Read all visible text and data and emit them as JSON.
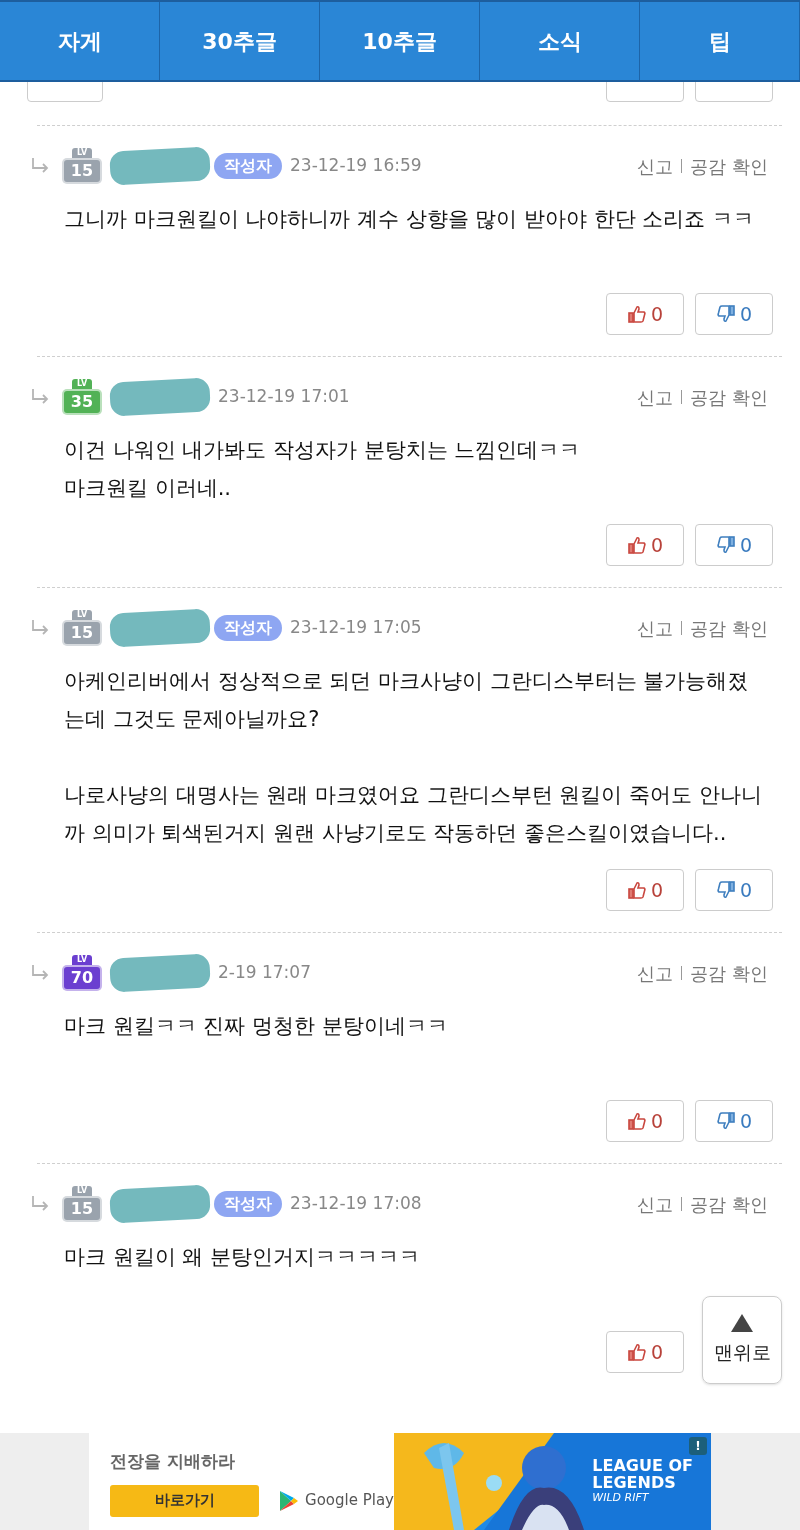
{
  "nav_tabs": [
    {
      "label": "자게",
      "selected": false
    },
    {
      "label": "30추글",
      "selected": false
    },
    {
      "label": "10추글",
      "selected": false
    },
    {
      "label": "소식",
      "selected": false
    },
    {
      "label": "팁",
      "selected": false
    }
  ],
  "comments": [
    {
      "level": {
        "top": "LV",
        "text": "15",
        "color": "#9aa3ad"
      },
      "name_redacted": true,
      "author_tag": "작성자",
      "date": "23-12-19 16:59",
      "report": "신고",
      "empathy": "공감 확인",
      "paragraphs": [
        [
          "그니까 마크원킬이 나야하니까 계수 상향을 많이 받아야 한단 소리죠 ㅋㅋ"
        ]
      ],
      "likes": "0",
      "dislikes": "0"
    },
    {
      "level": {
        "top": "LV",
        "text": "35",
        "color": "#52b256"
      },
      "name_redacted": true,
      "date": "23-12-19 17:01",
      "report": "신고",
      "empathy": "공감 확인",
      "paragraphs": [
        [
          "이건 나워인 내가봐도 작성자가 분탕치는 느낌인데ㅋㅋ",
          "마크원킬 이러네.."
        ]
      ],
      "likes": "0",
      "dislikes": "0"
    },
    {
      "level": {
        "top": "LV",
        "text": "15",
        "color": "#9aa3ad"
      },
      "name_redacted": true,
      "author_tag": "작성자",
      "date": "23-12-19 17:05",
      "report": "신고",
      "empathy": "공감 확인",
      "paragraphs": [
        [
          "아케인리버에서 정상적으로 되던 마크사냥이 그란디스부터는 불가능해졌는데 그것도 문제아닐까요?"
        ],
        [
          "나로사냥의 대명사는 원래 마크였어요 그란디스부턴 원킬이 죽어도 안나니까 의미가 퇴색된거지 원랜 사냥기로도 작동하던 좋은스킬이였습니다.."
        ]
      ],
      "likes": "0",
      "dislikes": "0"
    },
    {
      "level": {
        "top": "LV",
        "text": "70",
        "color": "#6b3fd0"
      },
      "name_redacted": true,
      "date": "2-19 17:07",
      "report": "신고",
      "empathy": "공감 확인",
      "paragraphs": [
        [
          "마크 원킬ㅋㅋ 진짜 멍청한 분탕이네ㅋㅋ"
        ]
      ],
      "likes": "0",
      "dislikes": "0"
    },
    {
      "level": {
        "top": "LV",
        "text": "15",
        "color": "#9aa3ad"
      },
      "name_redacted": true,
      "author_tag": "작성자",
      "date": "23-12-19 17:08",
      "report": "신고",
      "empathy": "공감 확인",
      "paragraphs": [
        [
          "마크 원킬이 왜 분탕인거지ㅋㅋㅋㅋㅋ"
        ]
      ],
      "likes": "0"
    }
  ],
  "top_button": {
    "label": "맨위로"
  },
  "ad": {
    "headline": "전장을 지배하라",
    "cta": "바로가기",
    "store": "Google Play",
    "logo_lines": [
      "LEAGUE OF",
      "LEGENDS",
      "WILD RIFT"
    ],
    "info": "!"
  }
}
